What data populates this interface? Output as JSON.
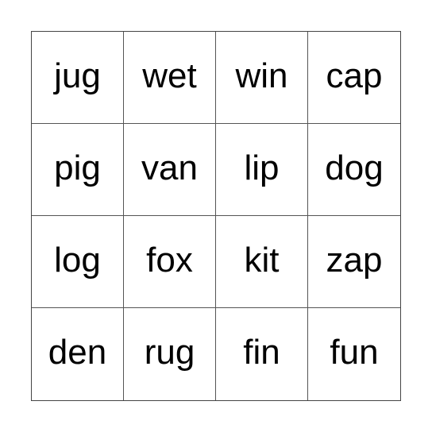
{
  "board": {
    "rows": [
      [
        "jug",
        "wet",
        "win",
        "cap"
      ],
      [
        "pig",
        "van",
        "lip",
        "dog"
      ],
      [
        "log",
        "fox",
        "kit",
        "zap"
      ],
      [
        "den",
        "rug",
        "fin",
        "fun"
      ]
    ]
  }
}
